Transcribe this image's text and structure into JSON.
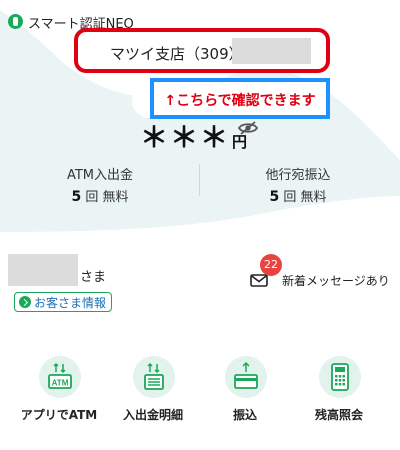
{
  "header": {
    "app_title": "スマート認証NEO",
    "app_icon": "shield-icon",
    "accent_color": "#1aa85a"
  },
  "account": {
    "branch_label": "マツイ支店（309）",
    "number_masked": "",
    "highlight_color": "#e00012"
  },
  "annotation": {
    "text": "↑こちらで確認できます",
    "border_color": "#1e90ff"
  },
  "balance": {
    "value": "＊＊＊",
    "unit": "円",
    "visibility_icon": "eye-off-icon"
  },
  "stats": [
    {
      "label": "ATM入出金",
      "count": "5",
      "unit": "回",
      "fee": "無料"
    },
    {
      "label": "他行宛振込",
      "count": "5",
      "unit": "回",
      "fee": "無料"
    }
  ],
  "user": {
    "name_masked": "",
    "honorific": "さま",
    "info_link": "お客さま情報"
  },
  "messages": {
    "badge_count": "22",
    "label": "新着メッセージあり",
    "badge_color": "#e8433f"
  },
  "actions": [
    {
      "label": "アプリでATM",
      "icon": "atm-icon"
    },
    {
      "label": "入出金明細",
      "icon": "statement-icon"
    },
    {
      "label": "振込",
      "icon": "transfer-card-icon"
    },
    {
      "label": "残高照会",
      "icon": "calculator-icon"
    }
  ]
}
